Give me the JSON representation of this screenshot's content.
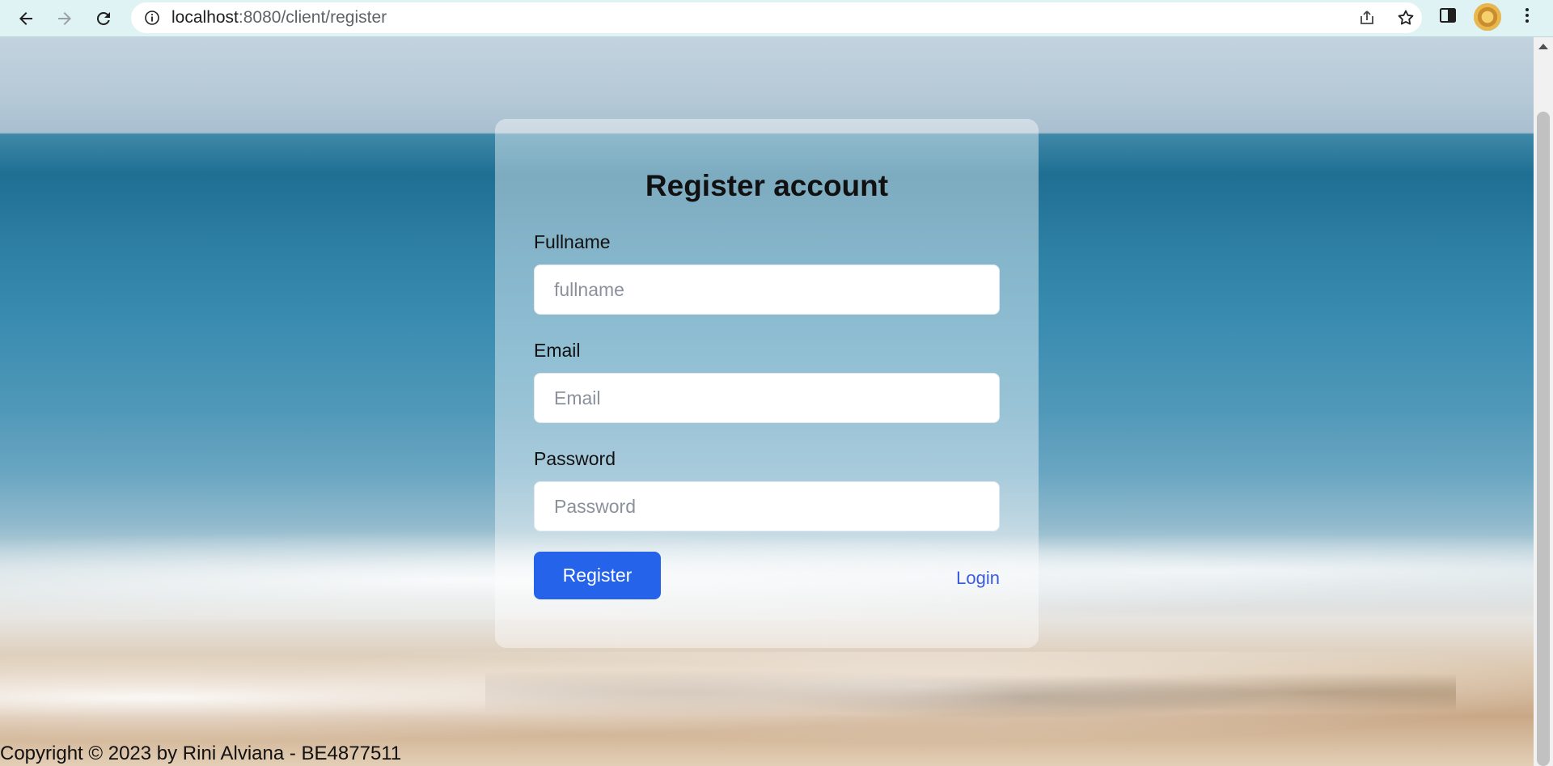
{
  "browser": {
    "url_host": "localhost",
    "url_path": ":8080/client/register",
    "icons": {
      "back": "back-arrow-icon",
      "forward": "forward-arrow-icon",
      "reload": "reload-icon",
      "info": "info-icon",
      "share": "share-icon",
      "bookmark": "star-icon",
      "side_panel": "side-panel-icon",
      "menu": "kebab-menu-icon"
    }
  },
  "form": {
    "title": "Register account",
    "fullname": {
      "label": "Fullname",
      "placeholder": "fullname",
      "value": ""
    },
    "email": {
      "label": "Email",
      "placeholder": "Email",
      "value": ""
    },
    "password": {
      "label": "Password",
      "placeholder": "Password",
      "value": ""
    },
    "register_label": "Register",
    "login_label": "Login"
  },
  "footer": {
    "copyright": "Copyright © 2023 by Rini Alviana - BE4877511"
  },
  "colors": {
    "primary_button": "#2563eb",
    "link": "#3b5bdb",
    "chrome_bg": "#dff3f4"
  }
}
